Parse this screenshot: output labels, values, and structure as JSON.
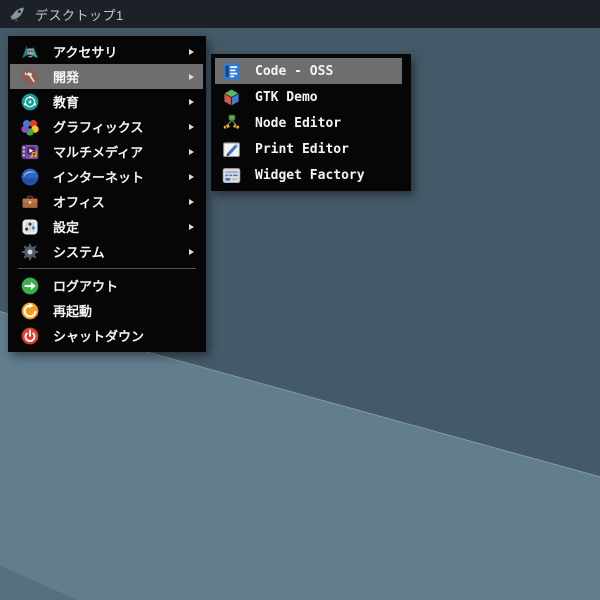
{
  "topbar": {
    "title": "デスクトップ1",
    "icon": "rocket-icon"
  },
  "menu": {
    "categories": [
      {
        "label": "アクセサリ",
        "icon": "accessories-icon",
        "has_submenu": true
      },
      {
        "label": "開発",
        "icon": "development-icon",
        "has_submenu": true,
        "highlighted": true
      },
      {
        "label": "教育",
        "icon": "education-icon",
        "has_submenu": true
      },
      {
        "label": "グラフィックス",
        "icon": "graphics-icon",
        "has_submenu": true
      },
      {
        "label": "マルチメディア",
        "icon": "multimedia-icon",
        "has_submenu": true
      },
      {
        "label": "インターネット",
        "icon": "internet-icon",
        "has_submenu": true
      },
      {
        "label": "オフィス",
        "icon": "office-icon",
        "has_submenu": true
      },
      {
        "label": "設定",
        "icon": "settings-icon",
        "has_submenu": true
      },
      {
        "label": "システム",
        "icon": "system-icon",
        "has_submenu": true
      }
    ],
    "actions": [
      {
        "label": "ログアウト",
        "icon": "logout-icon"
      },
      {
        "label": "再起動",
        "icon": "restart-icon"
      },
      {
        "label": "シャットダウン",
        "icon": "shutdown-icon"
      }
    ]
  },
  "submenu": {
    "items": [
      {
        "label": "Code - OSS",
        "icon": "code-oss-icon",
        "highlighted": true
      },
      {
        "label": "GTK Demo",
        "icon": "gtk-demo-icon"
      },
      {
        "label": "Node Editor",
        "icon": "node-editor-icon"
      },
      {
        "label": "Print Editor",
        "icon": "print-editor-icon"
      },
      {
        "label": "Widget Factory",
        "icon": "widget-factory-icon"
      }
    ]
  },
  "colors": {
    "topbar_bg": "#1b2127",
    "panel_bg": "#060606",
    "highlight": "#6e6e6e",
    "desktop_dark": "#455a69",
    "desktop_light": "#627d8d",
    "menu_text": "#f5f5f5"
  }
}
